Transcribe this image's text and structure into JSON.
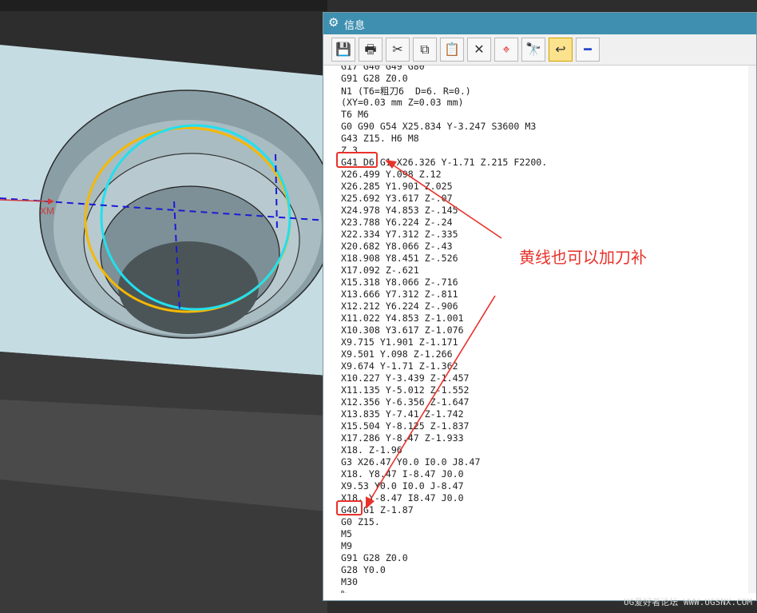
{
  "window": {
    "title": "信息",
    "gear_icon": "gear-icon"
  },
  "toolbar": {
    "buttons": [
      {
        "name": "save-button",
        "glyph": "💾"
      },
      {
        "name": "print-button",
        "glyph": "🖶"
      },
      {
        "name": "cut-button",
        "glyph": "✂"
      },
      {
        "name": "copy-button",
        "glyph": "⧉"
      },
      {
        "name": "paste-button",
        "glyph": "📋"
      },
      {
        "name": "delete-button",
        "glyph": "✕"
      },
      {
        "name": "target-button",
        "glyph": "⌖"
      },
      {
        "name": "find-button",
        "glyph": "🔭"
      },
      {
        "name": "wrap-button",
        "glyph": "↩"
      },
      {
        "name": "minimize-button",
        "glyph": "━"
      }
    ]
  },
  "code": {
    "lines": [
      "G17 G40 G49 G80",
      "G91 G28 Z0.0",
      "N1 (T6=粗刀6  D=6. R=0.)",
      "(XY=0.03 mm Z=0.03 mm)",
      "T6 M6",
      "G0 G90 G54 X25.834 Y-3.247 S3600 M3",
      "G43 Z15. H6 M8",
      "Z.3",
      "G41 D6 G1 X26.326 Y-1.71 Z.215 F2200.",
      "X26.499 Y.098 Z.12",
      "X26.285 Y1.901 Z.025",
      "X25.692 Y3.617 Z-.07",
      "X24.978 Y4.853 Z-.145",
      "X23.788 Y6.224 Z-.24",
      "X22.334 Y7.312 Z-.335",
      "X20.682 Y8.066 Z-.43",
      "X18.908 Y8.451 Z-.526",
      "X17.092 Z-.621",
      "X15.318 Y8.066 Z-.716",
      "X13.666 Y7.312 Z-.811",
      "X12.212 Y6.224 Z-.906",
      "X11.022 Y4.853 Z-1.001",
      "X10.308 Y3.617 Z-1.076",
      "X9.715 Y1.901 Z-1.171",
      "X9.501 Y.098 Z-1.266",
      "X9.674 Y-1.71 Z-1.362",
      "X10.227 Y-3.439 Z-1.457",
      "X11.135 Y-5.012 Z-1.552",
      "X12.356 Y-6.356 Z-1.647",
      "X13.835 Y-7.41 Z-1.742",
      "X15.504 Y-8.125 Z-1.837",
      "X17.286 Y-8.47 Z-1.933",
      "X18. Z-1.96",
      "G3 X26.47 Y0.0 I0.0 J8.47",
      "X18. Y8.47 I-8.47 J0.0",
      "X9.53 Y0.0 I0.0 J-8.47",
      "X18. Y-8.47 I8.47 J0.0",
      "G40 G1 Z-1.87",
      "G0 Z15.",
      "M5",
      "M9",
      "G91 G28 Z0.0",
      "G28 Y0.0",
      "M30",
      "%"
    ]
  },
  "annotation": {
    "text": "黄线也可以加刀补"
  },
  "viewport": {
    "axis_label": "XM"
  },
  "watermark": "UG爱好者论坛 WWW.UGSNX.COM",
  "colors": {
    "title_bar": "#3e8fb0",
    "annotation": "#e8322a",
    "toolpath_yellow": "#f5b800",
    "toolpath_cyan": "#22e0ee",
    "axis_blue": "#1a1ad6",
    "part_face": "#c6dce3"
  }
}
